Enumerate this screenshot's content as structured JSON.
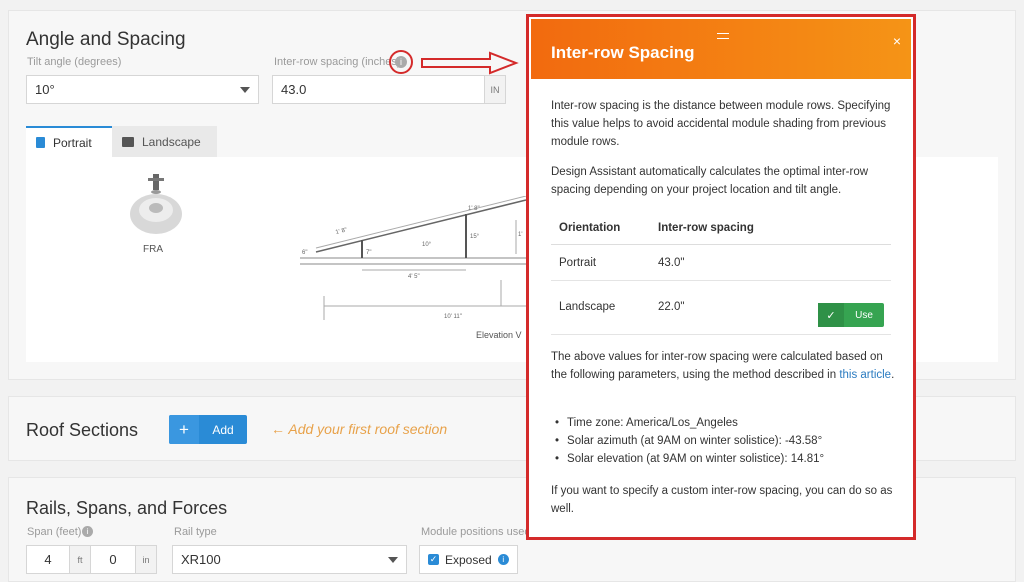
{
  "angle_section": {
    "title": "Angle and Spacing",
    "tilt_label": "Tilt angle (degrees)",
    "tilt_value": "10°",
    "spacing_label": "Inter-row spacing (inches)",
    "spacing_value": "43.0",
    "spacing_unit": "IN",
    "tabs": [
      "Portrait",
      "Landscape"
    ],
    "mount_label": "FRA",
    "drawing_labels": [
      "1' 8\"",
      "1' 8\"",
      "10°",
      "15°",
      "1'",
      "6\"",
      "7\"",
      "4' 5\"",
      "10' 11\"",
      "Elevation V"
    ]
  },
  "roof_section": {
    "title": "Roof Sections",
    "add_label": "Add",
    "hint": "Add your first roof section"
  },
  "rails_section": {
    "title": "Rails, Spans, and Forces",
    "span_label": "Span (feet)",
    "span_ft": "4",
    "span_ft_unit": "ft",
    "span_in": "0",
    "span_in_unit": "in",
    "rail_label": "Rail type",
    "rail_value": "XR100",
    "module_label": "Module positions used",
    "exposed_label": "Exposed"
  },
  "modal": {
    "title": "Inter-row Spacing",
    "close": "×",
    "p1": "Inter-row spacing is the distance between module rows. Specifying this value helps to avoid accidental module shading from previous module rows.",
    "p2": "Design Assistant automatically calculates the optimal inter-row spacing depending on your project location and tilt angle.",
    "table_headers": [
      "Orientation",
      "Inter-row spacing"
    ],
    "rows": [
      {
        "orientation": "Portrait",
        "spacing": "43.0\""
      },
      {
        "orientation": "Landscape",
        "spacing": "22.0\""
      }
    ],
    "use_label": "Use",
    "p3_a": "The above values for inter-row spacing were calculated based on the following parameters, using the method described in ",
    "p3_link": "this article",
    "p3_b": ".",
    "bullets": [
      "Time zone: America/Los_Angeles",
      "Solar azimuth (at 9AM on winter solistice): -43.58°",
      "Solar elevation (at 9AM on winter solistice): 14.81°"
    ],
    "p4": "If you want to specify a custom inter-row spacing, you can do so as well."
  },
  "colors": {
    "accent_blue": "#2a8bd6",
    "modal_orange": "#f26a0f",
    "annotation_red": "#d42a2a",
    "use_green": "#36a451",
    "hint_orange": "#e8a24a"
  }
}
